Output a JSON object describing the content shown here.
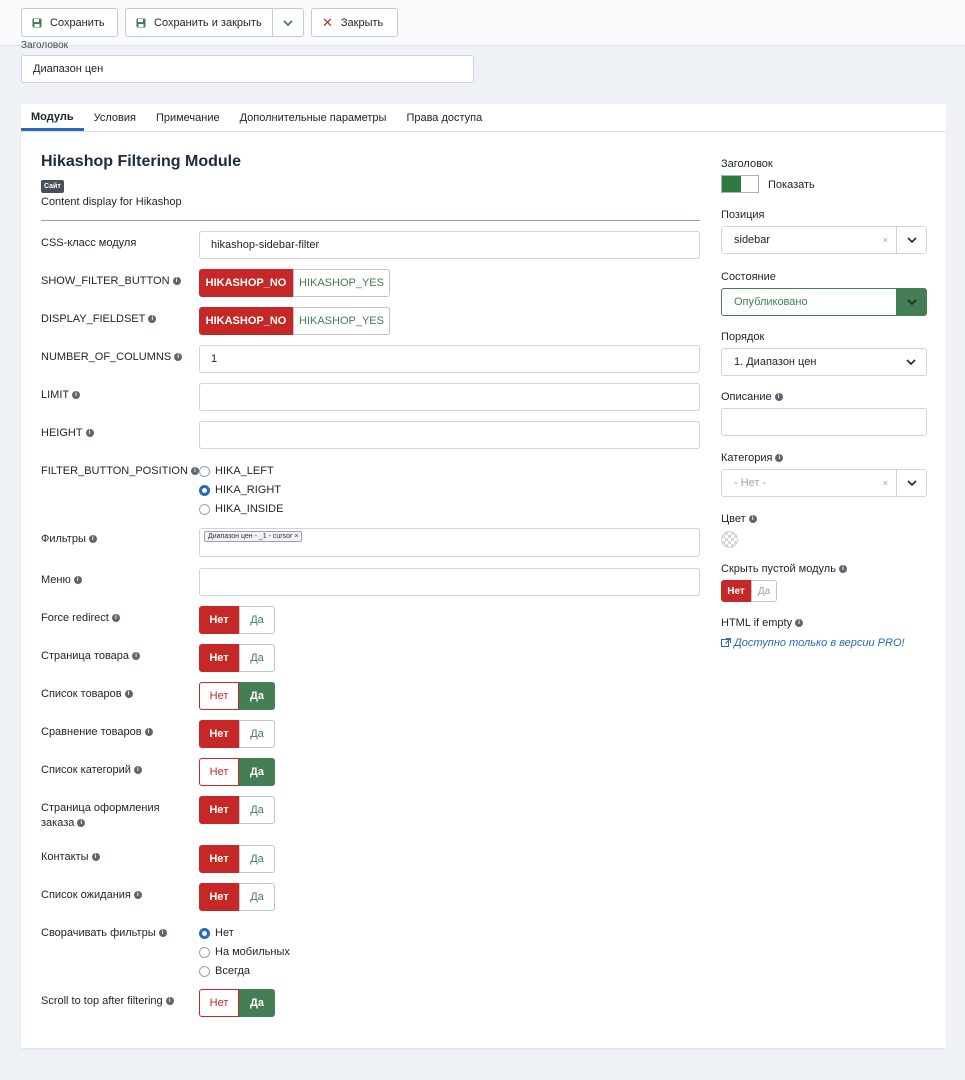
{
  "toolbar": {
    "save": "Сохранить",
    "save_close": "Сохранить и закрыть",
    "close": "Закрыть"
  },
  "title_field": {
    "label": "Заголовок",
    "value": "Диапазон цен"
  },
  "tabs": [
    "Модуль",
    "Условия",
    "Примечание",
    "Дополнительные параметры",
    "Права доступа"
  ],
  "module": {
    "name": "Hikashop Filtering Module",
    "badge": "Сайт",
    "description": "Content display for Hikashop"
  },
  "fields": {
    "css_class": {
      "label": "CSS-класс модуля",
      "value": "hikashop-sidebar-filter"
    },
    "show_filter_button": {
      "label": "SHOW_FILTER_BUTTON",
      "no": "HIKASHOP_NO",
      "yes": "HIKASHOP_YES"
    },
    "display_fieldset": {
      "label": "DISPLAY_FIELDSET",
      "no": "HIKASHOP_NO",
      "yes": "HIKASHOP_YES"
    },
    "number_of_columns": {
      "label": "NUMBER_OF_COLUMNS",
      "value": "1"
    },
    "limit": {
      "label": "LIMIT",
      "value": ""
    },
    "height": {
      "label": "HEIGHT",
      "value": ""
    },
    "filter_button_position": {
      "label": "FILTER_BUTTON_POSITION",
      "options": [
        "HIKA_LEFT",
        "HIKA_RIGHT",
        "HIKA_INSIDE"
      ],
      "selected": "HIKA_RIGHT"
    },
    "filters": {
      "label": "Фильтры",
      "chip": "Диапазон цен - _1 - cursor",
      "chip_remove": "×"
    },
    "menu": {
      "label": "Меню",
      "value": ""
    },
    "collapse_filters": {
      "label": "Сворачивать фильтры",
      "options": [
        "Нет",
        "На мобильных",
        "Всегда"
      ],
      "selected": "Нет"
    }
  },
  "yesno": {
    "no": "Нет",
    "yes": "Да"
  },
  "toggles": [
    {
      "label": "Force redirect",
      "value": "Нет"
    },
    {
      "label": "Страница товара",
      "value": "Нет"
    },
    {
      "label": "Список товаров",
      "value": "Да"
    },
    {
      "label": "Сравнение товаров",
      "value": "Нет"
    },
    {
      "label": "Список категорий",
      "value": "Да"
    },
    {
      "label": "Страница оформления заказа",
      "value": "Нет"
    },
    {
      "label": "Контакты",
      "value": "Нет"
    },
    {
      "label": "Список ожидания",
      "value": "Нет"
    }
  ],
  "scroll_to_top": {
    "label": "Scroll to top after filtering",
    "value": "Да"
  },
  "right": {
    "title_label": "Заголовок",
    "title_toggle": "Показать",
    "position": {
      "label": "Позиция",
      "value": "sidebar",
      "clear": "×"
    },
    "state": {
      "label": "Состояние",
      "value": "Опубликовано"
    },
    "order": {
      "label": "Порядок",
      "value": "1. Диапазон цен"
    },
    "description": {
      "label": "Описание",
      "value": ""
    },
    "category": {
      "label": "Категория",
      "value": "- Нет -",
      "clear": "×"
    },
    "color": {
      "label": "Цвет"
    },
    "hide_empty": {
      "label": "Скрыть пустой модуль",
      "no": "Нет",
      "yes": "Да"
    },
    "html_if_empty": {
      "label": "HTML if empty",
      "link": "Доступно только в версии PRO!"
    }
  },
  "colors": {
    "red": "#c52827",
    "green": "#457d54",
    "blue": "#2a69b8"
  }
}
